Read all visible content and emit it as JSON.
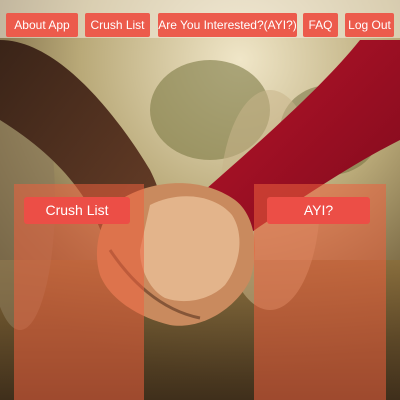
{
  "nav": {
    "about_label": "About App",
    "crush_label": "Crush List",
    "ayi_label": "Are You Interested?(AYI?)",
    "faq_label": "FAQ",
    "logout_label": "Log Out"
  },
  "main": {
    "crush_button_label": "Crush List",
    "ayi_button_label": "AYI?"
  },
  "colors": {
    "button": "#ec5b4c",
    "panel_overlay": "rgba(236, 96, 62, 0.55)",
    "navbar_bg": "rgba(244, 236, 224, 0.55)"
  }
}
